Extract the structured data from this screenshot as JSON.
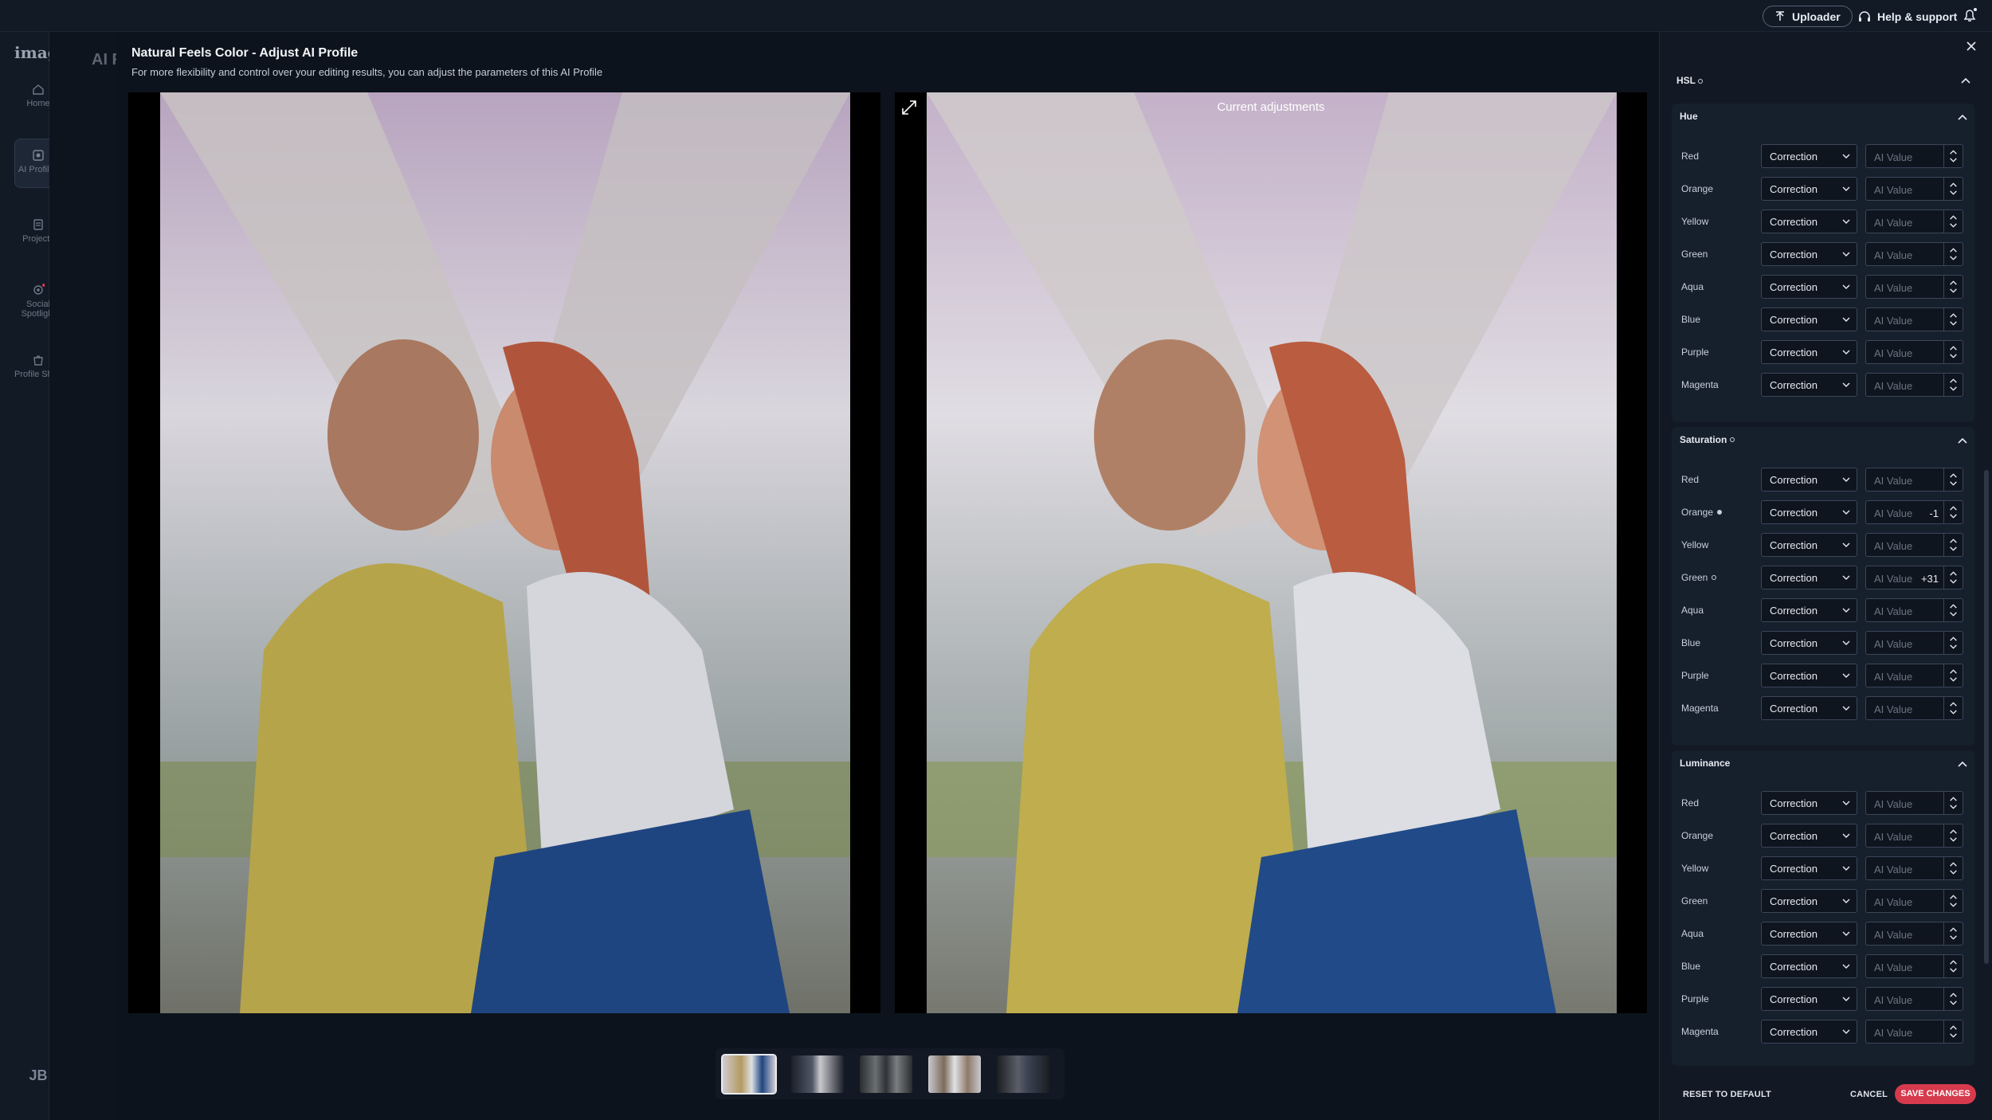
{
  "topbar": {
    "uploader_label": "Uploader",
    "help_label": "Help & support"
  },
  "sidebar": {
    "logo": "imagen",
    "items": [
      {
        "label": "Home"
      },
      {
        "label": "AI Profiles"
      },
      {
        "label": "Projects"
      },
      {
        "label": "Social Spotlight"
      },
      {
        "label": "Profile Shop"
      }
    ],
    "avatar": "JB"
  },
  "background_page": {
    "title_fragment": "AI F"
  },
  "modal": {
    "title": "Natural Feels Color - Adjust AI Profile",
    "subtitle": "For more flexibility and control over your editing results, you can adjust the parameters of this AI Profile",
    "current_label": "Current adjustments"
  },
  "panel": {
    "hsl_title": "HSL",
    "sections": [
      {
        "title": "Hue",
        "rows": [
          {
            "label": "Red",
            "mode": "Correction",
            "placeholder": "AI Value",
            "value": ""
          },
          {
            "label": "Orange",
            "mode": "Correction",
            "placeholder": "AI Value",
            "value": ""
          },
          {
            "label": "Yellow",
            "mode": "Correction",
            "placeholder": "AI Value",
            "value": ""
          },
          {
            "label": "Green",
            "mode": "Correction",
            "placeholder": "AI Value",
            "value": ""
          },
          {
            "label": "Aqua",
            "mode": "Correction",
            "placeholder": "AI Value",
            "value": ""
          },
          {
            "label": "Blue",
            "mode": "Correction",
            "placeholder": "AI Value",
            "value": ""
          },
          {
            "label": "Purple",
            "mode": "Correction",
            "placeholder": "AI Value",
            "value": ""
          },
          {
            "label": "Magenta",
            "mode": "Correction",
            "placeholder": "AI Value",
            "value": ""
          }
        ]
      },
      {
        "title": "Saturation",
        "rows": [
          {
            "label": "Red",
            "mode": "Correction",
            "placeholder": "AI Value",
            "value": ""
          },
          {
            "label": "Orange",
            "mode": "Correction",
            "placeholder": "AI Value",
            "value": "-1",
            "dot": "filled"
          },
          {
            "label": "Yellow",
            "mode": "Correction",
            "placeholder": "AI Value",
            "value": ""
          },
          {
            "label": "Green",
            "mode": "Correction",
            "placeholder": "AI Value",
            "value": "+31",
            "dot": "open"
          },
          {
            "label": "Aqua",
            "mode": "Correction",
            "placeholder": "AI Value",
            "value": ""
          },
          {
            "label": "Blue",
            "mode": "Correction",
            "placeholder": "AI Value",
            "value": ""
          },
          {
            "label": "Purple",
            "mode": "Correction",
            "placeholder": "AI Value",
            "value": ""
          },
          {
            "label": "Magenta",
            "mode": "Correction",
            "placeholder": "AI Value",
            "value": ""
          }
        ]
      },
      {
        "title": "Luminance",
        "rows": [
          {
            "label": "Red",
            "mode": "Correction",
            "placeholder": "AI Value",
            "value": ""
          },
          {
            "label": "Orange",
            "mode": "Correction",
            "placeholder": "AI Value",
            "value": ""
          },
          {
            "label": "Yellow",
            "mode": "Correction",
            "placeholder": "AI Value",
            "value": ""
          },
          {
            "label": "Green",
            "mode": "Correction",
            "placeholder": "AI Value",
            "value": ""
          },
          {
            "label": "Aqua",
            "mode": "Correction",
            "placeholder": "AI Value",
            "value": ""
          },
          {
            "label": "Blue",
            "mode": "Correction",
            "placeholder": "AI Value",
            "value": ""
          },
          {
            "label": "Purple",
            "mode": "Correction",
            "placeholder": "AI Value",
            "value": ""
          },
          {
            "label": "Magenta",
            "mode": "Correction",
            "placeholder": "AI Value",
            "value": ""
          }
        ]
      }
    ],
    "footer": {
      "reset_label": "RESET TO DEFAULT",
      "cancel_label": "CANCEL",
      "save_label": "SAVE CHANGES"
    }
  },
  "colors": {
    "accent_red": "#d63a4c",
    "panel_bg": "#121924",
    "modal_bg": "#0d131c"
  }
}
